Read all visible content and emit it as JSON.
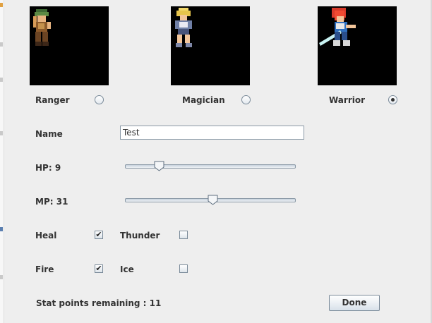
{
  "classes": [
    {
      "label": "Ranger",
      "selected": false
    },
    {
      "label": "Magician",
      "selected": false
    },
    {
      "label": "Warrior",
      "selected": true
    }
  ],
  "name": {
    "label": "Name",
    "value": "Test"
  },
  "hp": {
    "label": "HP: 9",
    "fraction": 0.18
  },
  "mp": {
    "label": "MP: 31",
    "fraction": 0.52
  },
  "spells": [
    {
      "label": "Heal",
      "checked": true
    },
    {
      "label": "Thunder",
      "checked": false
    },
    {
      "label": "Fire",
      "checked": true
    },
    {
      "label": "Ice",
      "checked": false
    }
  ],
  "status": {
    "text": "Stat points remaining : 11"
  },
  "done_button": {
    "label": "Done"
  }
}
